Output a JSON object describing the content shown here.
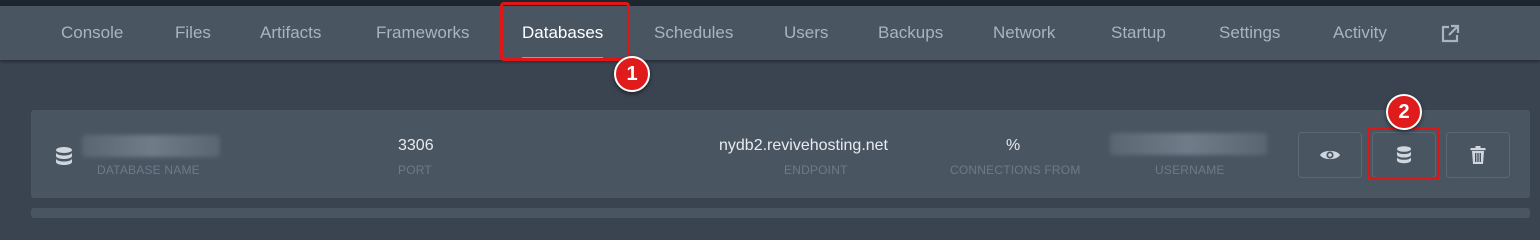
{
  "nav": {
    "tabs": [
      {
        "label": "Console"
      },
      {
        "label": "Files"
      },
      {
        "label": "Artifacts"
      },
      {
        "label": "Frameworks"
      },
      {
        "label": "Databases",
        "active": true
      },
      {
        "label": "Schedules"
      },
      {
        "label": "Users"
      },
      {
        "label": "Backups"
      },
      {
        "label": "Network"
      },
      {
        "label": "Startup"
      },
      {
        "label": "Settings"
      },
      {
        "label": "Activity"
      }
    ],
    "external_icon": "external-link-icon"
  },
  "annotations": {
    "step1": "1",
    "step2": "2",
    "color": "#e01515"
  },
  "database": {
    "icon": "database-icon",
    "name_label": "DATABASE NAME",
    "port": "3306",
    "port_label": "PORT",
    "endpoint": "nydb2.revivehosting.net",
    "endpoint_label": "ENDPOINT",
    "connections_from": "%",
    "connections_label": "CONNECTIONS FROM",
    "username_label": "USERNAME",
    "actions": {
      "view_icon": "eye-icon",
      "rotate_icon": "database-icon",
      "delete_icon": "trash-icon"
    }
  }
}
